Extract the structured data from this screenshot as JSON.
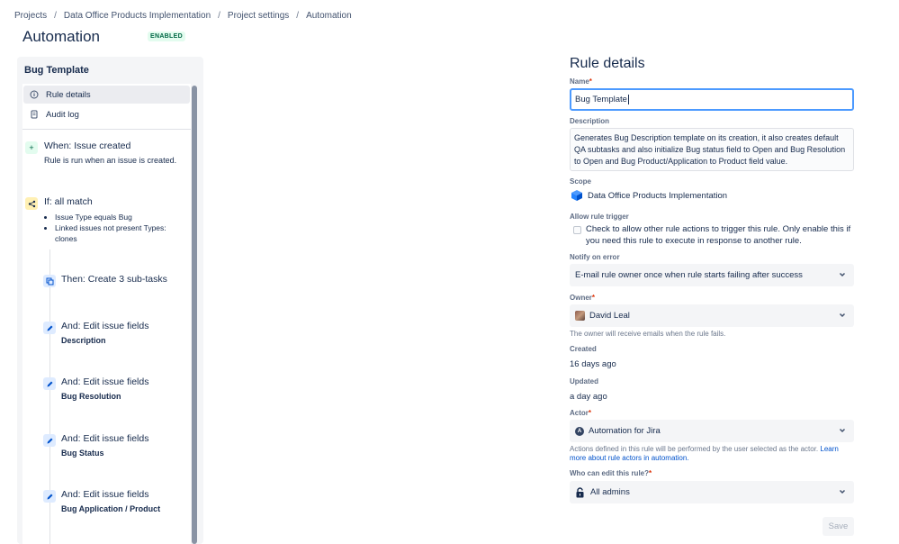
{
  "breadcrumb": {
    "items": [
      "Projects",
      "Data Office Products Implementation",
      "Project settings",
      "Automation"
    ]
  },
  "page": {
    "title": "Automation",
    "status_badge": "ENABLED"
  },
  "left_panel": {
    "title": "Bug Template",
    "nav": [
      {
        "label": "Rule details",
        "icon": "info-icon",
        "active": true
      },
      {
        "label": "Audit log",
        "icon": "document-icon",
        "active": false
      }
    ],
    "trigger": {
      "heading": "When: Issue created",
      "description": "Rule is run when an issue is created.",
      "icon": "plus-icon"
    },
    "condition": {
      "heading": "If: all match",
      "icon": "branch-icon",
      "items": [
        "Issue Type equals Bug",
        "Linked issues not present Types:",
        "clones"
      ]
    },
    "actions": [
      {
        "heading": "Then: Create 3 sub-tasks",
        "detail": "",
        "icon": "subtask-icon"
      },
      {
        "heading": "And: Edit issue fields",
        "detail": "Description",
        "icon": "pencil-icon"
      },
      {
        "heading": "And: Edit issue fields",
        "detail": "Bug Resolution",
        "icon": "pencil-icon"
      },
      {
        "heading": "And: Edit issue fields",
        "detail": "Bug Status",
        "icon": "pencil-icon"
      },
      {
        "heading": "And: Edit issue fields",
        "detail": "Bug Application / Product",
        "icon": "pencil-icon"
      }
    ]
  },
  "rule_details": {
    "title": "Rule details",
    "name_label": "Name",
    "name_value": "Bug Template",
    "description_label": "Description",
    "description_value": "Generates Bug Description template on its creation, it also creates default QA subtasks and also initialize Bug status field to Open and Bug Resolution to Open and Bug Product/Application to Product field value.",
    "scope_label": "Scope",
    "scope_value": "Data Office Products Implementation",
    "allow_trigger_label": "Allow rule trigger",
    "allow_trigger_text": "Check to allow other rule actions to trigger this rule. Only enable this if you need this rule to execute in response to another rule.",
    "notify_label": "Notify on error",
    "notify_value": "E-mail rule owner once when rule starts failing after success",
    "owner_label": "Owner",
    "owner_value": "David Leal",
    "owner_helper": "The owner will receive emails when the rule fails.",
    "created_label": "Created",
    "created_value": "16 days ago",
    "updated_label": "Updated",
    "updated_value": "a day ago",
    "actor_label": "Actor",
    "actor_value": "Automation for Jira",
    "actor_helper": "Actions defined in this rule will be performed by the user selected as the actor.",
    "actor_link": "Learn more about rule actors in automation.",
    "who_edit_label": "Who can edit this rule?",
    "who_edit_value": "All admins",
    "save_label": "Save",
    "required_mark": "*"
  },
  "colors": {
    "accent": "#0052cc",
    "focus": "#4c9aff",
    "badge_green": "#006644",
    "required": "#de350b"
  }
}
